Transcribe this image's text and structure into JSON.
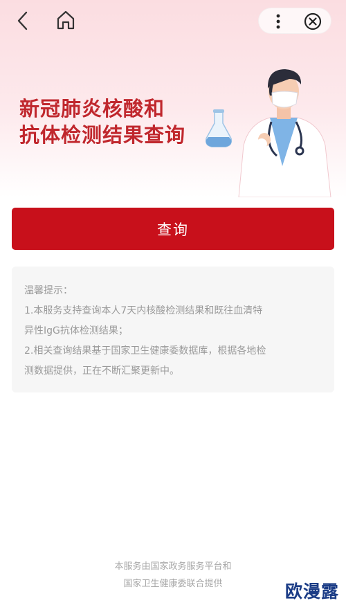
{
  "header": {
    "title_line1": "新冠肺炎核酸和",
    "title_line2": "抗体检测结果查询"
  },
  "nav": {
    "back_icon": "chevron-left-icon",
    "home_icon": "home-icon",
    "more_icon": "more-vertical-icon",
    "close_icon": "close-circle-icon"
  },
  "main": {
    "query_label": "查询"
  },
  "tips": {
    "heading": "温馨提示：",
    "line1": "1.本服务支持查询本人7天内核酸检测结果和既往血清特",
    "line2": "异性IgG抗体检测结果；",
    "line3": "2.相关查询结果基于国家卫生健康委数据库，根据各地检",
    "line4": "测数据提供，正在不断汇聚更新中。"
  },
  "footer": {
    "line1": "本服务由国家政务服务平台和",
    "line2": "国家卫生健康委联合提供"
  },
  "watermark": {
    "text": "欧漫露"
  },
  "colors": {
    "accent": "#c8101b",
    "title": "#c0272d",
    "hero_bg": "#fbdde1"
  }
}
